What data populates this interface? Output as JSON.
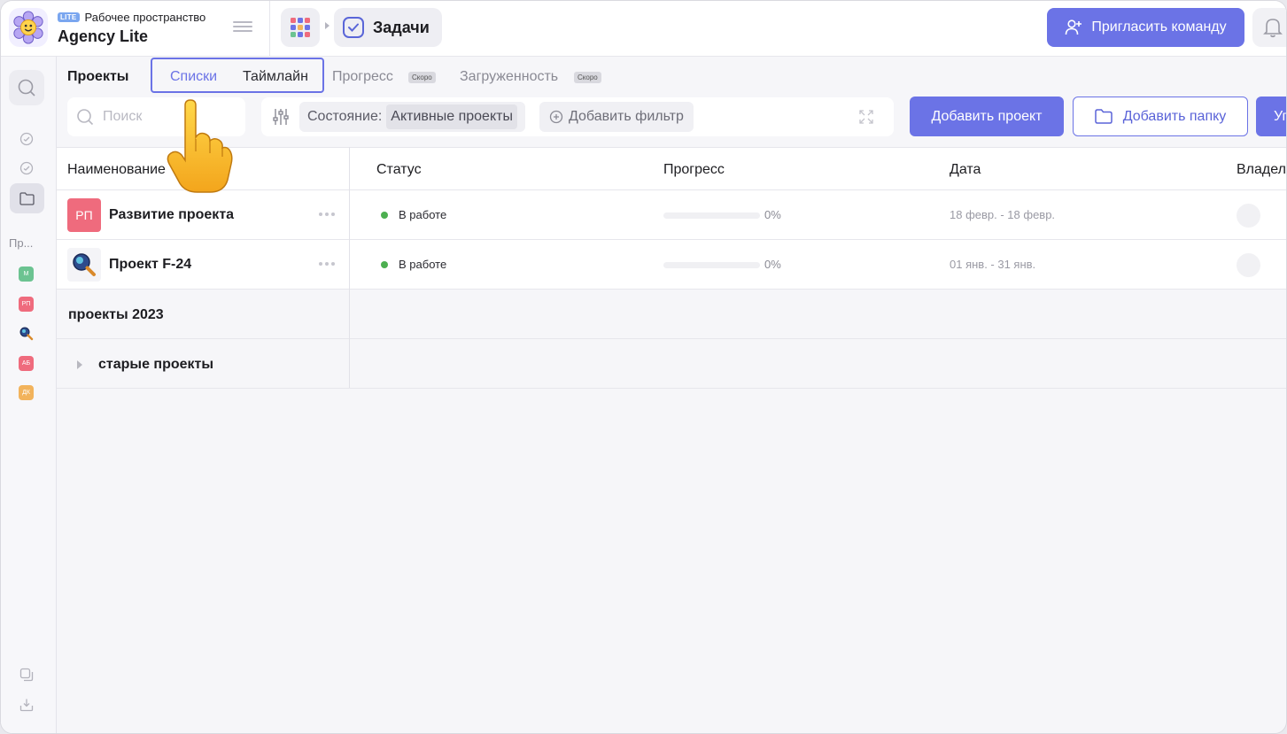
{
  "workspace": {
    "badge": "LITE",
    "subtitle": "Рабочее пространство",
    "name": "Agency Lite"
  },
  "breadcrumb": {
    "current": "Задачи"
  },
  "header": {
    "invite_label": "Пригласить команду"
  },
  "sidebar": {
    "section_label": "Пр...",
    "projects": [
      {
        "initials": "М",
        "color": "#6cc391"
      },
      {
        "initials": "РП",
        "color": "#ef6b7d"
      },
      {
        "initials": "",
        "icon": "magnifier-icon"
      },
      {
        "initials": "АБ",
        "color": "#ef6b7d"
      },
      {
        "initials": "ДК",
        "color": "#f2b35c"
      }
    ]
  },
  "tabs": {
    "projects": "Проекты",
    "lists": "Списки",
    "timeline": "Таймлайн",
    "progress": "Прогресс",
    "load": "Загруженность",
    "soon_badge": "Скоро"
  },
  "toolbar": {
    "search_placeholder": "Поиск",
    "state_label": "Состояние:",
    "state_value": "Активные проекты",
    "add_filter": "Добавить фильтр",
    "add_project": "Добавить проект",
    "add_folder": "Добавить папку",
    "more": "Уп"
  },
  "table": {
    "columns": [
      "Наименование",
      "Статус",
      "Прогресс",
      "Дата",
      "Владелец"
    ],
    "rows": [
      {
        "avatar": "РП",
        "avatar_color": "#ef6b7d",
        "name": "Развитие проекта",
        "status": "В работе",
        "progress": 0,
        "progress_label": "0%",
        "date": "18 февр. - 18 февр."
      },
      {
        "avatar": "",
        "avatar_icon": "magnifier-icon",
        "name": "Проект F-24",
        "status": "В работе",
        "progress": 0,
        "progress_label": "0%",
        "date": "01 янв. - 31 янв."
      }
    ],
    "groups": [
      {
        "name": "проекты 2023"
      },
      {
        "name": "старые проекты"
      }
    ]
  },
  "colors": {
    "accent": "#6b73e6",
    "status_active": "#4caf50"
  }
}
